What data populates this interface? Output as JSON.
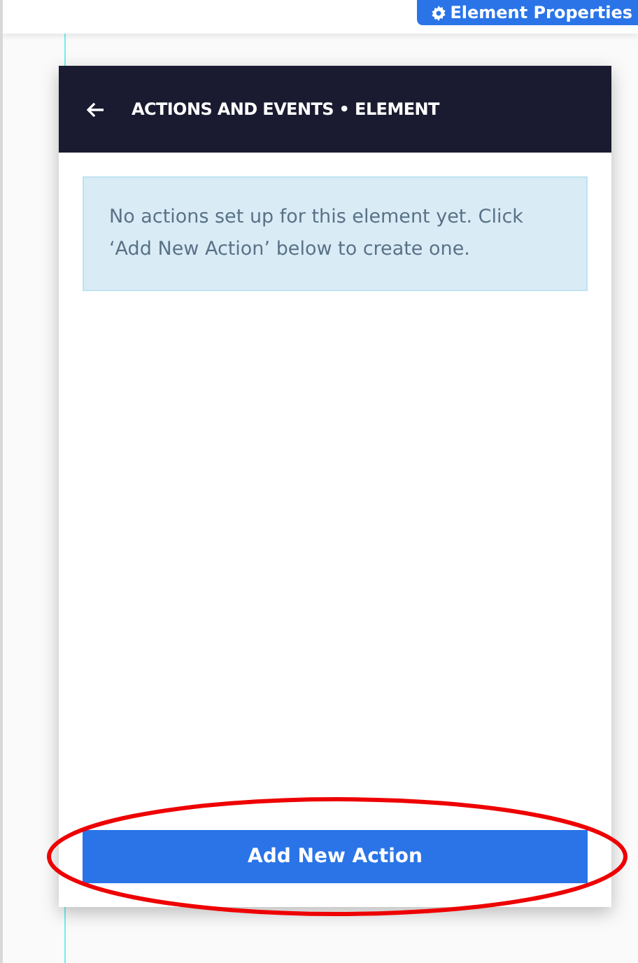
{
  "top_bar": {
    "button": {
      "label": "Element Properties"
    }
  },
  "panel": {
    "title": "ACTIONS AND EVENTS • ELEMENT",
    "message": "No actions set up for this element yet. Click ‘Add New Action’ below to create one.",
    "button": {
      "label": "Add New Action"
    }
  },
  "annotation": {
    "kind": "ellipse"
  }
}
